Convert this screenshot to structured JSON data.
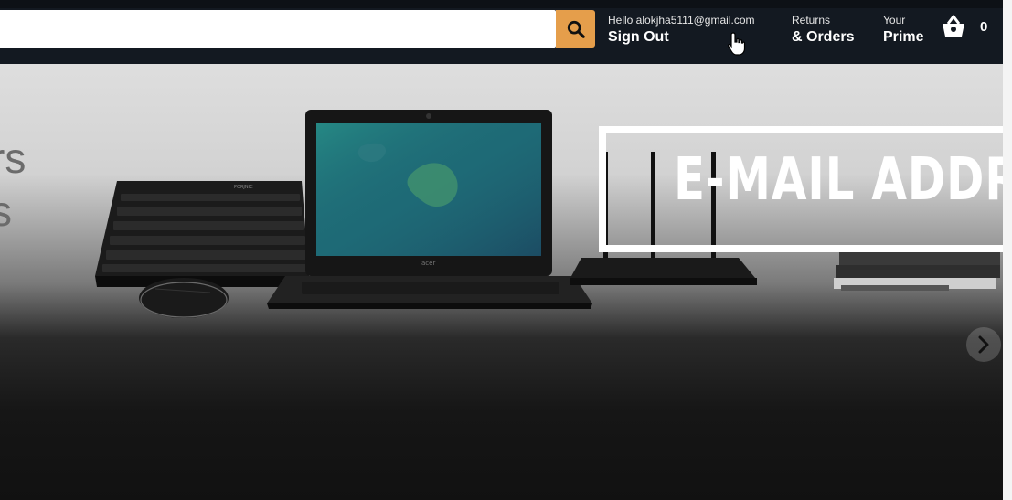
{
  "header": {
    "search": {
      "value": "",
      "placeholder": ""
    },
    "account": {
      "greeting": "Hello alokjha5111@gmail.com",
      "action": "Sign Out"
    },
    "orders": {
      "line1": "Returns",
      "line2": "& Orders"
    },
    "prime": {
      "line1": "Your",
      "line2": "Prime"
    },
    "cart": {
      "count": "0"
    }
  },
  "hero": {
    "partial_text_line1": "rs",
    "partial_text_line2": "s",
    "product_brands": {
      "keyboard": "PORJNIC",
      "laptop": "acer"
    }
  },
  "overlay": {
    "text": "E-MAIL ADDRE"
  },
  "colors": {
    "header_bg": "#131921",
    "search_button": "#e59e4b"
  },
  "icons": [
    "search-icon",
    "cart-icon",
    "chevron-right-icon",
    "hand-cursor-icon"
  ]
}
